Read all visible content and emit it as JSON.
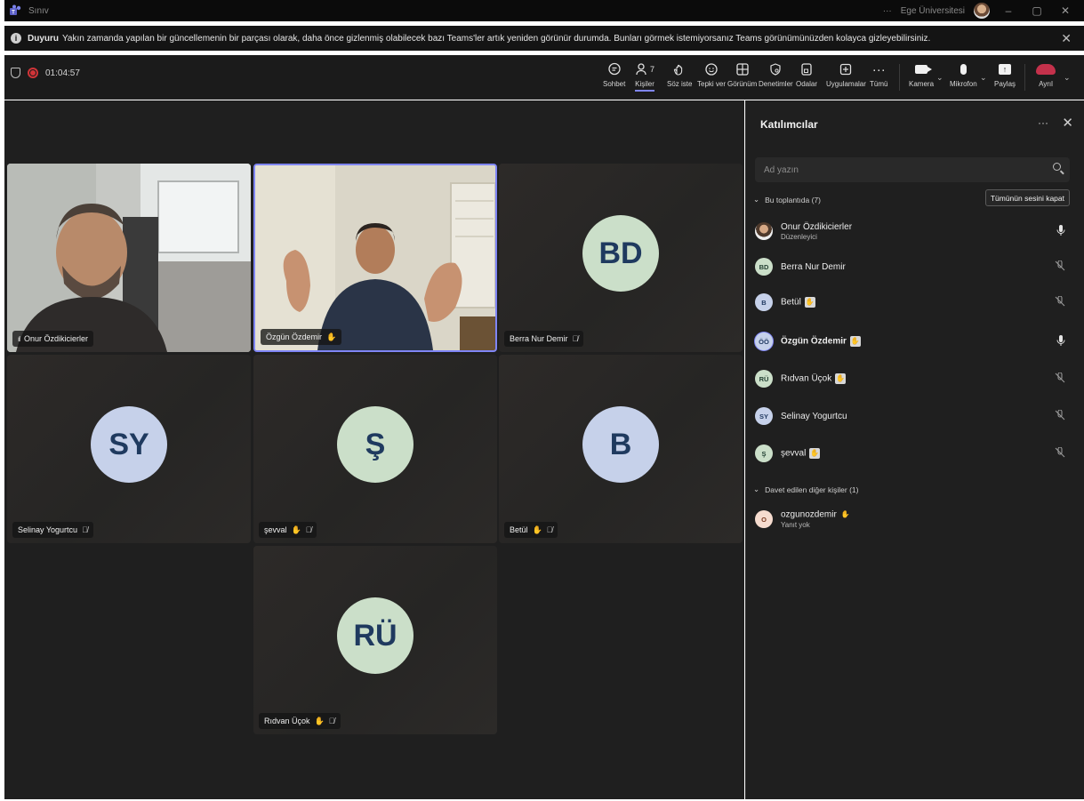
{
  "window": {
    "app_title": "Sınıv",
    "org_name": "Ege Üniversitesi",
    "more": "···",
    "minimize": "–",
    "restore": "▢",
    "close": "✕"
  },
  "announcement": {
    "title": "Duyuru",
    "text": "Yakın zamanda yapılan bir güncellemenin bir parçası olarak, daha önce gizlenmiş olabilecek bazı Teams'ler artık yeniden görünür durumda. Bunları görmek istemiyorsanız Teams görünümünüzden kolayca gizleyebilirsiniz.",
    "close": "✕"
  },
  "toolbar": {
    "timer": "01:04:57",
    "buttons": [
      {
        "label": "Sohbet",
        "icon": "☺"
      },
      {
        "label": "Kişiler",
        "icon": "8",
        "badge": "7"
      },
      {
        "label": "Söz iste",
        "icon": "✋"
      },
      {
        "label": "Tepki ver",
        "icon": "☺"
      },
      {
        "label": "Görünüm",
        "icon": "⊞"
      },
      {
        "label": "Denetimler",
        "icon": "⚙"
      },
      {
        "label": "Odalar",
        "icon": "◫"
      },
      {
        "label": "Uygulamalar",
        "icon": "⊞"
      },
      {
        "label": "Tümü",
        "icon": "···"
      },
      {
        "label": "Kamera"
      },
      {
        "label": "Mikrofon"
      },
      {
        "label": "Paylaş"
      },
      {
        "label": "Ayrıl"
      }
    ]
  },
  "stage": {
    "tiles": [
      {
        "name": "Onur Özdikicierler",
        "initials": ""
      },
      {
        "name": "Özgün Özdemir",
        "initials": ""
      },
      {
        "name": "Berra Nur Demir",
        "initials": "BD"
      },
      {
        "name": "Selinay Yogurtcu",
        "initials": "SY"
      },
      {
        "name": "şevval",
        "initials": "Ş"
      },
      {
        "name": "Betül",
        "initials": "B"
      },
      {
        "name": "Rıdvan Üçok",
        "initials": "RÜ"
      }
    ]
  },
  "panel": {
    "title": "Katılımcılar",
    "more": "···",
    "close": "✕",
    "search_placeholder": "Ad yazın",
    "in_meeting_header": "Bu toplantıda (7)",
    "mute_all": "Tümünün sesini kapat",
    "participants": [
      {
        "name": "Onur Özdikicierler",
        "role": "Düzenleyici",
        "initials": ""
      },
      {
        "name": "Berra Nur Demir",
        "initials": "BD"
      },
      {
        "name": "Betül",
        "initials": "B"
      },
      {
        "name": "Özgün Özdemir",
        "initials": "ÖÖ"
      },
      {
        "name": "Rıdvan Üçok",
        "initials": "RÜ"
      },
      {
        "name": "Selinay Yogurtcu",
        "initials": "SY"
      },
      {
        "name": "şevval",
        "initials": "Ş"
      }
    ],
    "invited_header": "Davet edilen diğer kişiler (1)",
    "invited": [
      {
        "name": "ozgunozdemir",
        "status": "Yanıt yok",
        "initials": "O"
      }
    ]
  },
  "colors": {
    "accent": "#7f85f5",
    "leave": "#c4314b",
    "record": "#d13438"
  }
}
